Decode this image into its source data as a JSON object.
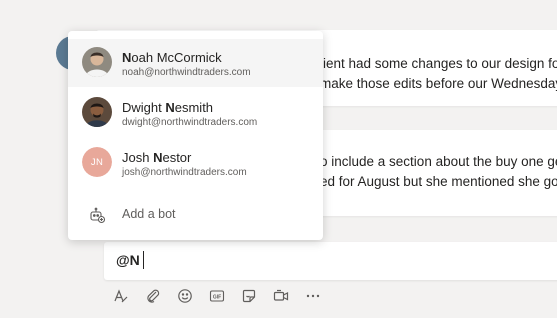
{
  "chat": {
    "message1": {
      "line1": "lient had some changes to our design for t",
      "line2": "make those edits before our Wednesday c"
    },
    "message2": {
      "line1": "o include a section about the buy one get",
      "line2": "ed for August but she mentioned she got t"
    }
  },
  "mention_popup": {
    "people": [
      {
        "name_bold": "N",
        "name_rest": "oah McCormick",
        "email": "noah@northwindtraders.com",
        "avatar": "photo",
        "highlighted": true
      },
      {
        "name_pre": "Dwight ",
        "name_bold": "N",
        "name_rest": "esmith",
        "email": "dwight@northwindtraders.com",
        "avatar": "photo"
      },
      {
        "name_pre": "Josh ",
        "name_bold": "N",
        "name_rest": "estor",
        "email": "josh@northwindtraders.com",
        "avatar": "initials",
        "initials": "JN"
      }
    ],
    "add_bot_label": "Add a bot"
  },
  "compose": {
    "value": "@N"
  },
  "toolbar": {
    "icons": [
      "format-icon",
      "attach-icon",
      "emoji-icon",
      "gif-icon",
      "sticker-icon",
      "meet-icon",
      "more-icon"
    ]
  },
  "colors": {
    "background": "#f3f2f1",
    "initials_avatar": "#e8a89a"
  }
}
